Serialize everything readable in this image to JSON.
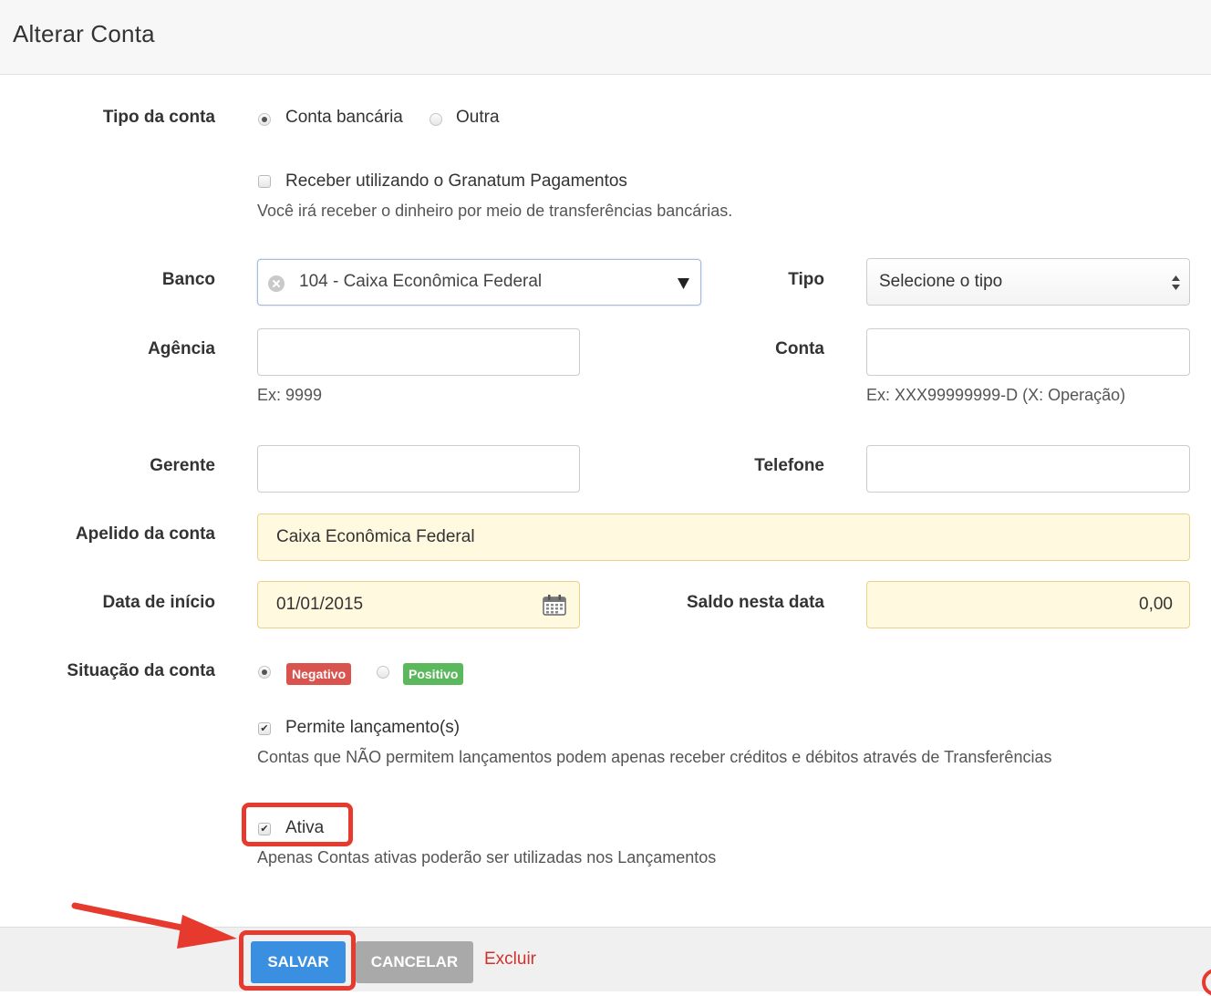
{
  "header": {
    "title": "Alterar Conta"
  },
  "tipo_conta": {
    "label": "Tipo da conta",
    "options": [
      "Conta bancária",
      "Outra"
    ],
    "selected": "Conta bancária"
  },
  "granatum": {
    "checkbox_label": "Receber utilizando o Granatum Pagamentos",
    "checked": false,
    "help": "Você irá receber o dinheiro por meio de transferências bancárias."
  },
  "banco": {
    "label": "Banco",
    "value": "104 - Caixa Econômica Federal"
  },
  "tipo": {
    "label": "Tipo",
    "placeholder": "Selecione o tipo"
  },
  "agencia": {
    "label": "Agência",
    "value": "",
    "help": "Ex: 9999"
  },
  "conta": {
    "label": "Conta",
    "value": "",
    "help": "Ex: XXX99999999-D (X: Operação)"
  },
  "gerente": {
    "label": "Gerente",
    "value": ""
  },
  "telefone": {
    "label": "Telefone",
    "value": ""
  },
  "apelido": {
    "label": "Apelido da conta",
    "value": "Caixa Econômica Federal"
  },
  "data_inicio": {
    "label": "Data de início",
    "value": "01/01/2015"
  },
  "saldo": {
    "label": "Saldo nesta data",
    "value": "0,00"
  },
  "situacao": {
    "label": "Situação da conta",
    "options": [
      "Negativo",
      "Positivo"
    ],
    "selected": "Negativo",
    "colors": {
      "negativo": "#d9534f",
      "positivo": "#5cb85c"
    }
  },
  "permite_lancamentos": {
    "checkbox_label": "Permite lançamento(s)",
    "checked": true,
    "help": "Contas que NÃO permitem lançamentos podem apenas receber créditos e débitos através de Transferências"
  },
  "ativa": {
    "checkbox_label": "Ativa",
    "checked": true,
    "help": "Apenas Contas ativas poderão ser utilizadas nos Lançamentos"
  },
  "footer": {
    "save_label": "SALVAR",
    "cancel_label": "CANCELAR",
    "delete_label": "Excluir"
  },
  "colors": {
    "primary": "#3b8fe0",
    "cancel": "#a9a9a9",
    "danger": "#d0312d",
    "highlight": "#e63a2e"
  },
  "icons": {
    "clear": "clear-circle-icon",
    "dropdown": "caret-down-icon",
    "sort": "sort-arrows-icon",
    "calendar": "calendar-icon"
  }
}
